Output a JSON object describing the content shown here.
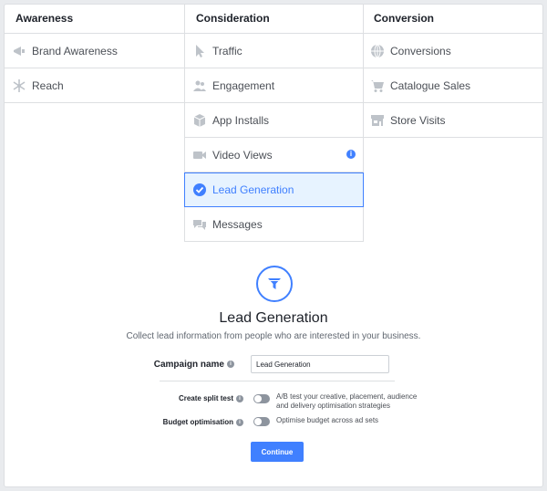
{
  "columns": [
    {
      "header": "Awareness",
      "items": [
        {
          "label": "Brand Awareness",
          "icon": "megaphone-icon"
        },
        {
          "label": "Reach",
          "icon": "snowflake-icon"
        }
      ]
    },
    {
      "header": "Consideration",
      "items": [
        {
          "label": "Traffic",
          "icon": "cursor-icon"
        },
        {
          "label": "Engagement",
          "icon": "people-icon"
        },
        {
          "label": "App Installs",
          "icon": "box-icon"
        },
        {
          "label": "Video Views",
          "icon": "video-icon",
          "info": "i"
        },
        {
          "label": "Lead Generation",
          "icon": "check-circle-icon",
          "selected": true
        },
        {
          "label": "Messages",
          "icon": "chat-icon"
        }
      ]
    },
    {
      "header": "Conversion",
      "items": [
        {
          "label": "Conversions",
          "icon": "globe-icon"
        },
        {
          "label": "Catalogue Sales",
          "icon": "cart-icon"
        },
        {
          "label": "Store Visits",
          "icon": "store-icon"
        }
      ]
    }
  ],
  "detail": {
    "icon": "funnel-icon",
    "title": "Lead Generation",
    "description": "Collect lead information from people who are interested in your business."
  },
  "form": {
    "campaign_name_label": "Campaign name",
    "campaign_name_value": "Lead Generation",
    "split_test_label": "Create split test",
    "split_test_desc_1": "A/B test your creative, placement, audience",
    "split_test_desc_2": "and delivery optimisation strategies",
    "budget_label": "Budget optimisation",
    "budget_desc": "Optimise budget across ad sets",
    "continue_label": "Continue",
    "info_glyph": "i"
  },
  "colors": {
    "accent": "#4080ff",
    "icon_gray": "#bec3c9",
    "selected_bg": "#e7f3ff"
  }
}
